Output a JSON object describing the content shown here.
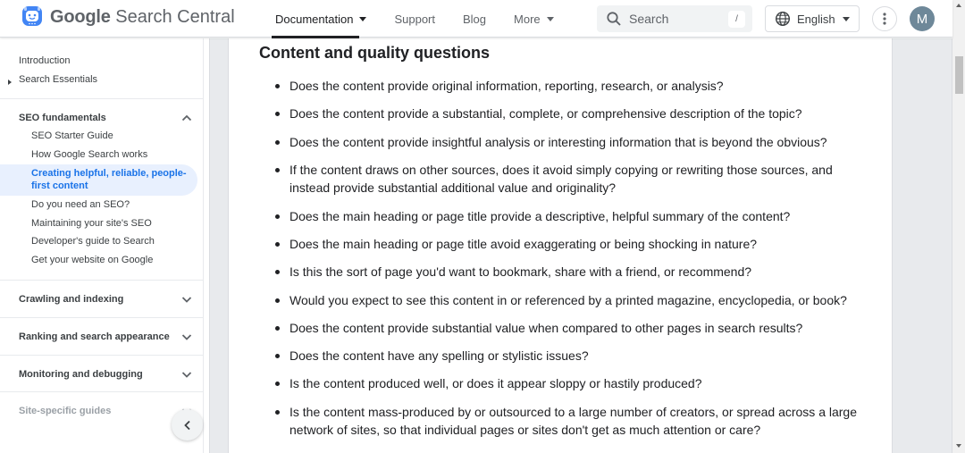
{
  "header": {
    "brand": {
      "google": "Google",
      "product": "Search Central"
    },
    "nav": [
      {
        "label": "Documentation",
        "has_dropdown": true,
        "active": true
      },
      {
        "label": "Support",
        "has_dropdown": false,
        "active": false
      },
      {
        "label": "Blog",
        "has_dropdown": false,
        "active": false
      },
      {
        "label": "More",
        "has_dropdown": true,
        "active": false
      }
    ],
    "search": {
      "placeholder": "Search",
      "shortcut": "/"
    },
    "language": "English",
    "avatar_initial": "M"
  },
  "sidebar": {
    "top_links": [
      "Introduction",
      "Search Essentials"
    ],
    "seo_fundamentals": {
      "title": "SEO fundamentals",
      "expanded": true,
      "items": [
        "SEO Starter Guide",
        "How Google Search works",
        "Creating helpful, reliable, people-first content",
        "Do you need an SEO?",
        "Maintaining your site's SEO",
        "Developer's guide to Search",
        "Get your website on Google"
      ],
      "active_index": 2
    },
    "sections": [
      "Crawling and indexing",
      "Ranking and search appearance",
      "Monitoring and debugging",
      "Site-specific guides"
    ]
  },
  "main": {
    "heading": "Content and quality questions",
    "questions": [
      "Does the content provide original information, reporting, research, or analysis?",
      "Does the content provide a substantial, complete, or comprehensive description of the topic?",
      "Does the content provide insightful analysis or interesting information that is beyond the obvious?",
      "If the content draws on other sources, does it avoid simply copying or rewriting those sources, and instead provide substantial additional value and originality?",
      "Does the main heading or page title provide a descriptive, helpful summary of the content?",
      "Does the main heading or page title avoid exaggerating or being shocking in nature?",
      "Is this the sort of page you'd want to bookmark, share with a friend, or recommend?",
      "Would you expect to see this content in or referenced by a printed magazine, encyclopedia, or book?",
      "Does the content provide substantial value when compared to other pages in search results?",
      "Does the content have any spelling or stylistic issues?",
      "Is the content produced well, or does it appear sloppy or hastily produced?",
      "Is the content mass-produced by or outsourced to a large number of creators, or spread across a large network of sites, so that individual pages or sites don't get as much attention or care?"
    ]
  },
  "colors": {
    "accent": "#1a73e8",
    "active_bg": "#e8f0fe",
    "avatar_bg": "#6e8899",
    "logo_blue": "#4285f4"
  }
}
